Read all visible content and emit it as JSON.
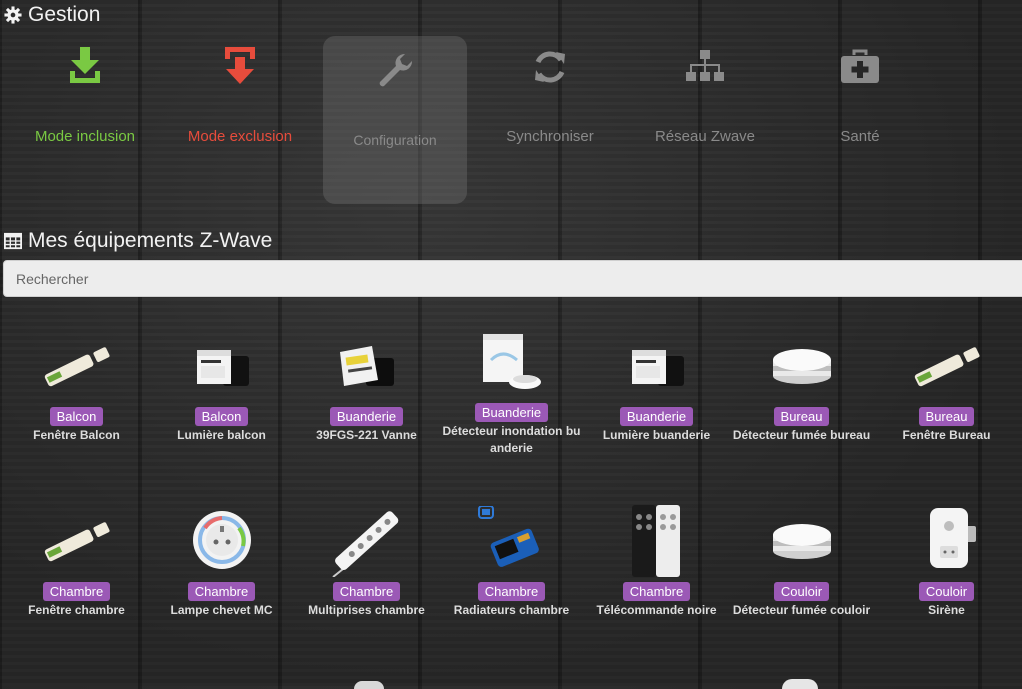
{
  "gestion": {
    "title": "Gestion",
    "items": [
      {
        "label": "Mode inclusion",
        "color": "#7ac943",
        "icon": "download-icon"
      },
      {
        "label": "Mode exclusion",
        "color": "#e74c3c",
        "icon": "upload-icon"
      },
      {
        "label": "Configuration",
        "color": "#8a8a8a",
        "icon": "wrench-icon"
      },
      {
        "label": "Synchroniser",
        "color": "#8a8a8a",
        "icon": "refresh-icon"
      },
      {
        "label": "Réseau Zwave",
        "color": "#8a8a8a",
        "icon": "sitemap-icon"
      },
      {
        "label": "Santé",
        "color": "#8a8a8a",
        "icon": "medkit-icon"
      }
    ]
  },
  "equipements": {
    "title": "Mes équipements Z-Wave",
    "search_placeholder": "Rechercher",
    "badge_color": "#9b59b6",
    "devices": [
      {
        "room": "Balcon",
        "name": "Fenêtre Balcon",
        "icon": "door-sensor-icon"
      },
      {
        "room": "Balcon",
        "name": "Lumière balcon",
        "icon": "micromodule-icon"
      },
      {
        "room": "Buanderie",
        "name": "39FGS-221 Vanne",
        "icon": "relay-module-icon"
      },
      {
        "room": "Buanderie",
        "name": "Détecteur inondation buanderie",
        "icon": "flood-sensor-icon"
      },
      {
        "room": "Buanderie",
        "name": "Lumière buanderie",
        "icon": "micromodule-icon"
      },
      {
        "room": "Bureau",
        "name": "Détecteur fumée bureau",
        "icon": "smoke-detector-icon"
      },
      {
        "room": "Bureau",
        "name": "Fenêtre Bureau",
        "icon": "door-sensor-icon"
      },
      {
        "room": "Chambre",
        "name": "Fenêtre chambre",
        "icon": "door-sensor-icon"
      },
      {
        "room": "Chambre",
        "name": "Lampe chevet MC",
        "icon": "wall-plug-icon"
      },
      {
        "room": "Chambre",
        "name": "Multiprises chambre",
        "icon": "power-strip-icon"
      },
      {
        "room": "Chambre",
        "name": "Radiateurs chambre",
        "icon": "pilot-wire-icon"
      },
      {
        "room": "Chambre",
        "name": "Télécommande noire",
        "icon": "remote-icon"
      },
      {
        "room": "Couloir",
        "name": "Détecteur fumée couloir",
        "icon": "smoke-detector-icon"
      },
      {
        "room": "Couloir",
        "name": "Sirène",
        "icon": "siren-icon"
      }
    ]
  }
}
